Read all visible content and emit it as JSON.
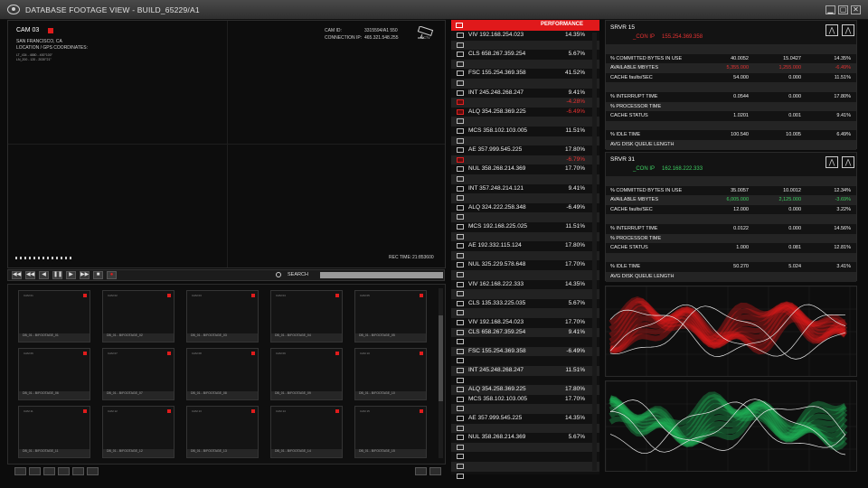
{
  "title": "DATABASE FOOTAGE VIEW - BUILD_65229/A1",
  "window_buttons": [
    "▁",
    "▢",
    "✕"
  ],
  "cam": {
    "name": "CAM 03",
    "city": "SAN FRANCISCO, CA",
    "location_label": "LOCATION / GPS COORDINATES:",
    "lat": "LT_434 - 4880 - 400°100\"",
    "lon": "LN_200 - 120 - 2030°21\"",
    "cam_id_label": "CAM ID:",
    "cam_id": "3315594/A1 550",
    "conn_label": "CONNECTION IP:",
    "conn_ip": "465.321.548.255",
    "cctv": "CCTV",
    "rec_label": "REC TIME:",
    "rec_time": "21:853600",
    "progress": 0.12
  },
  "controls": {
    "buttons": [
      "◀◀",
      "◀◀",
      "◀",
      "❚❚",
      "▶",
      "▶▶",
      "■",
      "●"
    ],
    "search_label": "SEARCH"
  },
  "thumbs": [
    {
      "cam": "CAM 01",
      "label": "DB_01 - B/FOOTAGE_01"
    },
    {
      "cam": "CAM 02",
      "label": "DB_01 - B/FOOTAGE_02"
    },
    {
      "cam": "CAM 03",
      "label": "DB_01 - B/FOOTAGE_03"
    },
    {
      "cam": "CAM 04",
      "label": "DB_01 - B/FOOTAGE_04"
    },
    {
      "cam": "CAM 05",
      "label": "DB_01 - B/FOOTAGE_05"
    },
    {
      "cam": "CAM 06",
      "label": "DB_01 - B/FOOTAGE_06"
    },
    {
      "cam": "CAM 07",
      "label": "DB_01 - B/FOOTAGE_07"
    },
    {
      "cam": "CAM 08",
      "label": "DB_01 - B/FOOTAGE_08"
    },
    {
      "cam": "CAM 09",
      "label": "DB_01 - B/FOOTAGE_09"
    },
    {
      "cam": "CAM 10",
      "label": "DB_01 - B/FOOTAGE_10"
    },
    {
      "cam": "CAM 11",
      "label": "DB_01 - B/FOOTAGE_11"
    },
    {
      "cam": "CAM 12",
      "label": "DB_01 - B/FOOTAGE_12"
    },
    {
      "cam": "CAM 13",
      "label": "DB_01 - B/FOOTAGE_13"
    },
    {
      "cam": "CAM 14",
      "label": "DB_01 - B/FOOTAGE_14"
    },
    {
      "cam": "CAM 15",
      "label": "DB_01 - B/FOOTAGE_15"
    }
  ],
  "list": {
    "header_right": "PERFORMANCE",
    "rows": [
      {
        "name": "VIV  192.168.254.023",
        "pct": "14.35%",
        "red": false
      },
      {
        "name": "",
        "pct": "",
        "red": false
      },
      {
        "name": "CLS   658.267.359.254",
        "pct": "5.67%",
        "red": false
      },
      {
        "name": "",
        "pct": "",
        "red": false
      },
      {
        "name": "FSC   155.254.369.358",
        "pct": "41.52%",
        "red": false
      },
      {
        "name": "",
        "pct": "",
        "red": false
      },
      {
        "name": "INT    245.248.268.247",
        "pct": "9.41%",
        "red": false
      },
      {
        "name": "",
        "pct": "-4.28%",
        "red": true,
        "redicon": true
      },
      {
        "name": "ALQ   354.258.369.225",
        "pct": "-6.49%",
        "red": true,
        "redicon": true
      },
      {
        "name": "",
        "pct": "",
        "red": false
      },
      {
        "name": "MCS   358.102.103.005",
        "pct": "11.51%",
        "red": false
      },
      {
        "name": "",
        "pct": "",
        "red": false
      },
      {
        "name": "AE  357.999.545.225",
        "pct": "17.80%",
        "red": false
      },
      {
        "name": "",
        "pct": "-6.79%",
        "red": true,
        "redicon": true
      },
      {
        "name": "NUL   358.268.214.369",
        "pct": "17.70%",
        "red": false
      },
      {
        "name": "",
        "pct": "",
        "red": false
      },
      {
        "name": "INT    357.248.214.121",
        "pct": "9.41%",
        "red": false
      },
      {
        "name": "",
        "pct": "",
        "red": false
      },
      {
        "name": "ALQ   324.222.258.348",
        "pct": "-6.49%",
        "red": false
      },
      {
        "name": "",
        "pct": "",
        "red": false
      },
      {
        "name": "MCS   192.168.225.025",
        "pct": "11.51%",
        "red": false
      },
      {
        "name": "",
        "pct": "",
        "red": false
      },
      {
        "name": "AE  192.332.115.124",
        "pct": "17.80%",
        "red": false
      },
      {
        "name": "",
        "pct": "",
        "red": false
      },
      {
        "name": "NUL   325.229.578.648",
        "pct": "17.70%",
        "red": false
      },
      {
        "name": "",
        "pct": "",
        "red": false
      },
      {
        "name": "VIV  162.168.222.333",
        "pct": "14.35%",
        "red": false
      },
      {
        "name": "",
        "pct": "",
        "red": false
      },
      {
        "name": "CLS   135.333.225.035",
        "pct": "5.67%",
        "red": false
      },
      {
        "name": "",
        "pct": "",
        "red": false
      },
      {
        "name": "VIV  192.168.254.023",
        "pct": "17.70%",
        "red": false
      },
      {
        "name": "CLS   658.267.359.254",
        "pct": "9.41%",
        "red": false
      },
      {
        "name": "",
        "pct": "",
        "red": false
      },
      {
        "name": "FSC   155.254.369.358",
        "pct": "-6.49%",
        "red": false
      },
      {
        "name": "",
        "pct": "",
        "red": false
      },
      {
        "name": "INT    245.248.268.247",
        "pct": "11.51%",
        "red": false
      },
      {
        "name": "",
        "pct": "",
        "red": false
      },
      {
        "name": "ALQ   354.258.369.225",
        "pct": "17.80%",
        "red": false
      },
      {
        "name": "MCS   358.102.103.005",
        "pct": "17.70%",
        "red": false
      },
      {
        "name": "",
        "pct": "",
        "red": false
      },
      {
        "name": "AE  357.999.545.225",
        "pct": "14.35%",
        "red": false
      },
      {
        "name": "",
        "pct": "",
        "red": false
      },
      {
        "name": "NUL   358.268.214.369",
        "pct": "5.67%",
        "red": false
      },
      {
        "name": "",
        "pct": "",
        "red": false
      },
      {
        "name": "",
        "pct": "",
        "red": false
      },
      {
        "name": "",
        "pct": "",
        "red": false
      },
      {
        "name": "",
        "pct": "",
        "red": false
      }
    ]
  },
  "servers": [
    {
      "title": "SRVR 15",
      "conn_label": "_CON IP",
      "conn_ip": "155.254.369.358",
      "conn_color": "#e63232",
      "rows": [
        {
          "label": "",
          "a": "",
          "b": "",
          "c": ""
        },
        {
          "label": "% COMMITTED BYTES IN USE",
          "a": "40.0052",
          "b": "15.0427",
          "c": "14.35%"
        },
        {
          "label": "AVAILABLE MBYTES",
          "a": "5,355.000",
          "b": "1,255.000",
          "c": "-6.49%",
          "color": "#e63232"
        },
        {
          "label": "CACHE faults/SEC",
          "a": "54.000",
          "b": "0.000",
          "c": "11.51%"
        },
        {
          "label": "",
          "a": "",
          "b": "",
          "c": ""
        },
        {
          "label": "% INTERRUPT TIME",
          "a": "0.0544",
          "b": "0.000",
          "c": "17.80%"
        },
        {
          "label": "% PROCESSOR TIME",
          "a": "",
          "b": "",
          "c": ""
        },
        {
          "label": "CACHE STATUS",
          "a": "1.0201",
          "b": "0.001",
          "c": "9.41%"
        },
        {
          "label": "",
          "a": "",
          "b": "",
          "c": ""
        },
        {
          "label": "% IDLE TIME",
          "a": "100.540",
          "b": "10.005",
          "c": "6.49%"
        },
        {
          "label": "AVG DISK QUEUE LENGTH",
          "a": "",
          "b": "",
          "c": ""
        }
      ]
    },
    {
      "title": "SRVR 31",
      "conn_label": "_CON IP",
      "conn_ip": "162.168.222.333",
      "conn_color": "#3ecf62",
      "rows": [
        {
          "label": "",
          "a": "",
          "b": "",
          "c": ""
        },
        {
          "label": "% COMMITTED BYTES IN USE",
          "a": "35.0057",
          "b": "10.0012",
          "c": "12.34%"
        },
        {
          "label": "AVAILABLE MBYTES",
          "a": "6,005.000",
          "b": "2,125.000",
          "c": "-3.69%",
          "color": "#3ecf62"
        },
        {
          "label": "CACHE faults/SEC",
          "a": "12.000",
          "b": "0.000",
          "c": "3.22%"
        },
        {
          "label": "",
          "a": "",
          "b": "",
          "c": ""
        },
        {
          "label": "% INTERRUPT TIME",
          "a": "0.0122",
          "b": "0.000",
          "c": "14.56%"
        },
        {
          "label": "% PROCESSOR TIME",
          "a": "",
          "b": "",
          "c": ""
        },
        {
          "label": "CACHE STATUS",
          "a": "1.000",
          "b": "0.081",
          "c": "12.81%"
        },
        {
          "label": "",
          "a": "",
          "b": "",
          "c": ""
        },
        {
          "label": "% IDLE TIME",
          "a": "50.270",
          "b": "5.024",
          "c": "3.41%"
        },
        {
          "label": "AVG DISK QUEUE LENGTH",
          "a": "",
          "b": "",
          "c": ""
        }
      ]
    }
  ],
  "colors": {
    "accent_red": "#e0191b",
    "accent_green": "#1fb85a"
  },
  "icons": {
    "titlebar": "eye-icon",
    "camera": "cctv-camera-icon",
    "logo": "mountain-logo-icon"
  }
}
